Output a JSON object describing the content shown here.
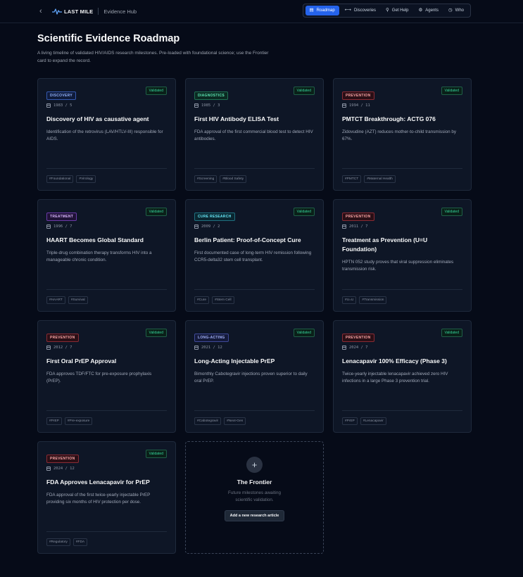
{
  "header": {
    "brand": "LAST MILE",
    "section": "Evidence Hub",
    "nav": [
      {
        "label": "Roadmap",
        "icon": "▤",
        "name": "roadmap",
        "active": true
      },
      {
        "label": "Discoveries",
        "icon": "⟷",
        "name": "discoveries",
        "active": false
      },
      {
        "label": "Get Help",
        "icon": "⚲",
        "name": "get-help",
        "active": false
      },
      {
        "label": "Agents",
        "icon": "⚙",
        "name": "agents",
        "active": false
      },
      {
        "label": "Who",
        "icon": "◷",
        "name": "who",
        "active": false
      }
    ]
  },
  "page": {
    "title": "Scientific Evidence Roadmap",
    "subtitle": "A living timeline of validated HIV/AIDS research milestones. Pre-loaded with foundational science; use the Frontier card to expand the record."
  },
  "cards": [
    {
      "category": "DISCOVERY",
      "cat_class": "discovery",
      "status": "Validated",
      "date": "1983 / 5",
      "title": "Discovery of HIV as causative agent",
      "desc": "Identification of the retrovirus (LAV/HTLV-III) responsible for AIDS.",
      "tags": [
        "#Foundational",
        "#Virology"
      ]
    },
    {
      "category": "DIAGNOSTICS",
      "cat_class": "diagnostics",
      "status": "Validated",
      "date": "1985 / 3",
      "title": "First HIV Antibody ELISA Test",
      "desc": "FDA approval of the first commercial blood test to detect HIV antibodies.",
      "tags": [
        "#Screening",
        "#Blood Safety"
      ]
    },
    {
      "category": "PREVENTION",
      "cat_class": "prevention",
      "status": "Validated",
      "date": "1994 / 11",
      "title": "PMTCT Breakthrough: ACTG 076",
      "desc": "Zidovudine (AZT) reduces mother-to-child transmission by 67%.",
      "tags": [
        "#PMTCT",
        "#Maternal Health"
      ]
    },
    {
      "category": "TREATMENT",
      "cat_class": "treatment",
      "status": "Validated",
      "date": "1996 / 7",
      "title": "HAART Becomes Global Standard",
      "desc": "Triple-drug combination therapy transforms HIV into a manageable chronic condition.",
      "tags": [
        "#HAART",
        "#Survival"
      ]
    },
    {
      "category": "CURE RESEARCH",
      "cat_class": "cure",
      "status": "Validated",
      "date": "2009 / 2",
      "title": "Berlin Patient: Proof-of-Concept Cure",
      "desc": "First documented case of long-term HIV remission following CCR5-delta32 stem cell transplant.",
      "tags": [
        "#Cure",
        "#Stem Cell"
      ]
    },
    {
      "category": "PREVENTION",
      "cat_class": "prevention",
      "status": "Validated",
      "date": "2011 / 7",
      "title": "Treatment as Prevention (U=U Foundation)",
      "desc": "HPTN 052 study proves that viral suppression eliminates transmission risk.",
      "tags": [
        "#U=U",
        "#Transmission"
      ]
    },
    {
      "category": "PREVENTION",
      "cat_class": "prevention",
      "status": "Validated",
      "date": "2012 / 7",
      "title": "First Oral PrEP Approval",
      "desc": "FDA approves TDF/FTC for pre-exposure prophylaxis (PrEP).",
      "tags": [
        "#PrEP",
        "#Pre-exposure"
      ]
    },
    {
      "category": "LONG-ACTING",
      "cat_class": "longacting",
      "status": "Validated",
      "date": "2021 / 12",
      "title": "Long-Acting Injectable PrEP",
      "desc": "Bimonthly Cabotegravir injections proven superior to daily oral PrEP.",
      "tags": [
        "#Cabotegravir",
        "#Next-Gen"
      ]
    },
    {
      "category": "PREVENTION",
      "cat_class": "prevention",
      "status": "Validated",
      "date": "2024 / 7",
      "title": "Lenacapavir 100% Efficacy (Phase 3)",
      "desc": "Twice-yearly injectable lenacapavir achieved zero HIV infections in a large Phase 3 prevention trial.",
      "tags": [
        "#PrEP",
        "#Lenacapavir"
      ]
    },
    {
      "category": "PREVENTION",
      "cat_class": "prevention",
      "status": "Validated",
      "date": "2024 / 12",
      "title": "FDA Approves Lenacapavir for PrEP",
      "desc": "FDA approval of the first twice-yearly injectable PrEP providing six months of HIV protection per dose.",
      "tags": [
        "#Regulatory",
        "#FDA"
      ]
    }
  ],
  "frontier": {
    "icon": "+",
    "title": "The Frontier",
    "desc": "Future milestones awaiting scientific validation.",
    "button": "Add a new research article"
  }
}
